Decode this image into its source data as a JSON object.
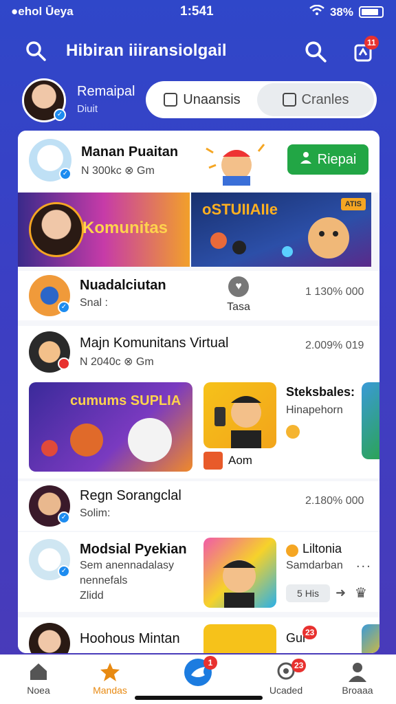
{
  "status": {
    "carrier": "●ehol Ūeya",
    "time": "1:541",
    "battery": "38%"
  },
  "header": {
    "title": "Hibiran iiiransiolgail",
    "notif_badge": "11"
  },
  "profile": {
    "name": "Remaipal",
    "sub": "Diuit"
  },
  "segments": {
    "opt1": "Unaansis",
    "opt2": "Cranles"
  },
  "feed": {
    "row1": {
      "title": "Manan Puaitan",
      "sub": "N 300kc ⊗ Gm",
      "button": "Riepai"
    },
    "banner": {
      "left": "Komunitas",
      "right": "oSTUIIAIIe",
      "tag": "ATIS"
    },
    "row2": {
      "title": "Nuadalciutan",
      "sub": "Snal :",
      "like": "Tasa",
      "num": "1 130% 000"
    },
    "row3": {
      "title": "Majn Komunitans Virtual",
      "sub": "N 2040c ⊗ Gm",
      "num": "2.009% 019"
    },
    "tile_a": {
      "text": "cumums SUPLIA"
    },
    "tile_b": {
      "caption": "Aom"
    },
    "side1": {
      "title": "Steksbales:",
      "sub": "Hinapehorn"
    },
    "row4": {
      "title": "Regn Sorangclal",
      "sub": "Solim:",
      "num": "2.180% 000"
    },
    "row5": {
      "title": "Modsial Pyekian",
      "sub1": "Sem anennadalasy",
      "sub2": "nennefals",
      "sub3": "Zlidd"
    },
    "side2": {
      "title": "Liltonia",
      "sub": "Samdarban",
      "chip": "5 His",
      "dots": "..."
    },
    "row6": {
      "title": "Hoohous Mintan",
      "side": "Gul",
      "badge": "23"
    }
  },
  "nav": {
    "items": [
      {
        "label": "Noea"
      },
      {
        "label": "Mandas"
      },
      {
        "label": ""
      },
      {
        "label": "Ucaded"
      },
      {
        "label": "Broaaa"
      }
    ],
    "center_badge": "1",
    "item4_badge": "23"
  },
  "colors": {
    "accent": "#e88a12",
    "primary": "#2f47c9",
    "follow": "#22a645"
  }
}
